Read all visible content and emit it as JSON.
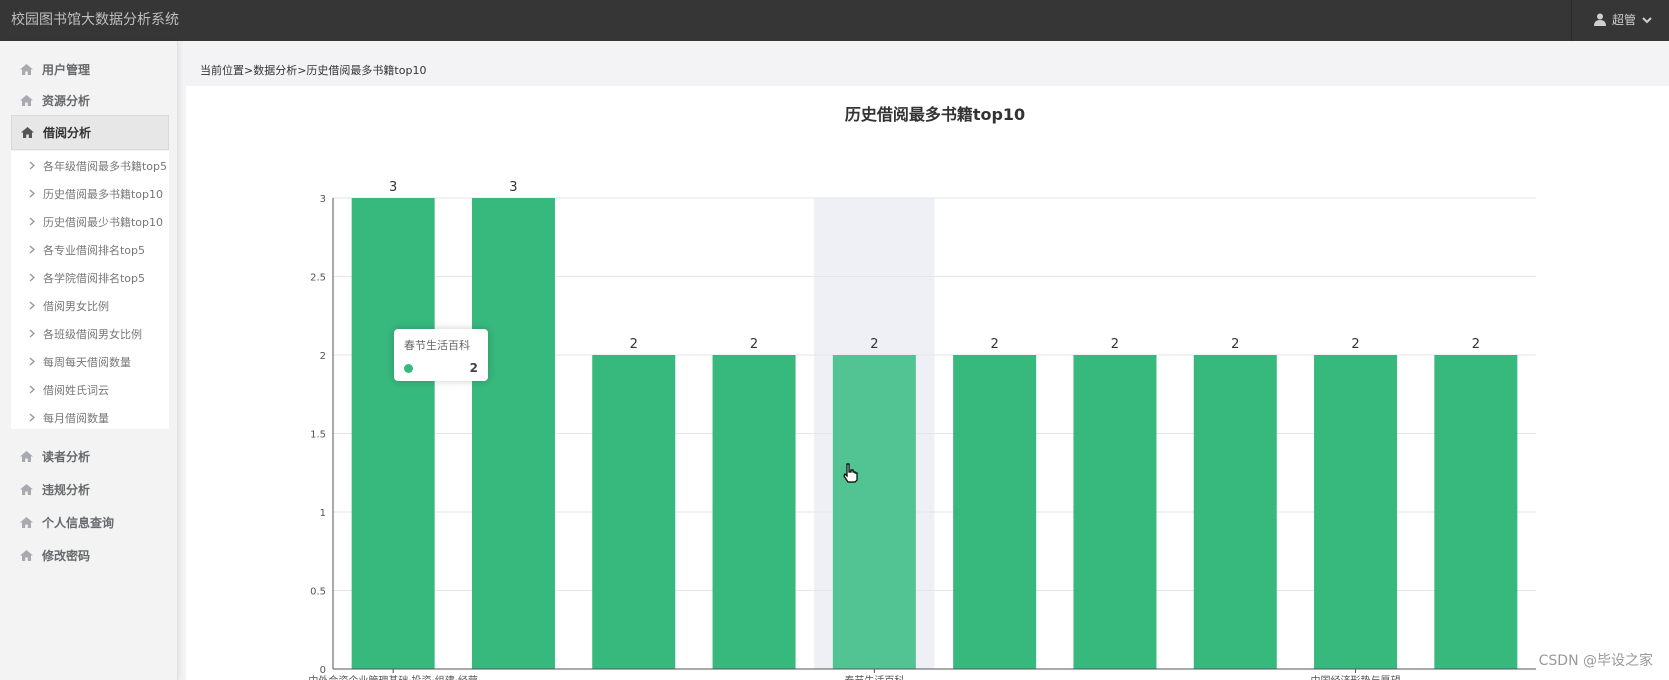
{
  "app": {
    "title": "校园图书馆大数据分析系统"
  },
  "user": {
    "name": "超管"
  },
  "sidebar": {
    "items": [
      {
        "label": "用户管理"
      },
      {
        "label": "资源分析"
      },
      {
        "label": "借阅分析"
      },
      {
        "label": "读者分析"
      },
      {
        "label": "违规分析"
      },
      {
        "label": "个人信息查询"
      },
      {
        "label": "修改密码"
      }
    ],
    "submenu": [
      {
        "label": "各年级借阅最多书籍top5"
      },
      {
        "label": "历史借阅最多书籍top10"
      },
      {
        "label": "历史借阅最少书籍top10"
      },
      {
        "label": "各专业借阅排名top5"
      },
      {
        "label": "各学院借阅排名top5"
      },
      {
        "label": "借阅男女比例"
      },
      {
        "label": "各班级借阅男女比例"
      },
      {
        "label": "每周每天借阅数量"
      },
      {
        "label": "借阅姓氏词云"
      },
      {
        "label": "每月借阅数量"
      }
    ]
  },
  "breadcrumb": {
    "text": "当前位置>数据分析>历史借阅最多书籍top10"
  },
  "tooltip": {
    "title": "春节生活百科",
    "value": "2"
  },
  "watermark": "CSDN @毕设之家",
  "colors": {
    "bar": "#37b87d",
    "highlight": "#eef0f6",
    "topbar": "#363636"
  },
  "chart_data": {
    "type": "bar",
    "title": "历史借阅最多书籍top10",
    "categories": [
      "中外合资企业管理基础·投资·组建·经营",
      "",
      "",
      "",
      "春节生活百科",
      "",
      "",
      "",
      "中国经济形势与愿望",
      ""
    ],
    "values": [
      3,
      3,
      2,
      2,
      2,
      2,
      2,
      2,
      2,
      2
    ],
    "ylim": [
      0,
      3
    ],
    "yticks": [
      "0",
      "0.5",
      "1",
      "1.5",
      "2",
      "2.5",
      "3"
    ],
    "grid": true,
    "highlighted_index": 4
  }
}
